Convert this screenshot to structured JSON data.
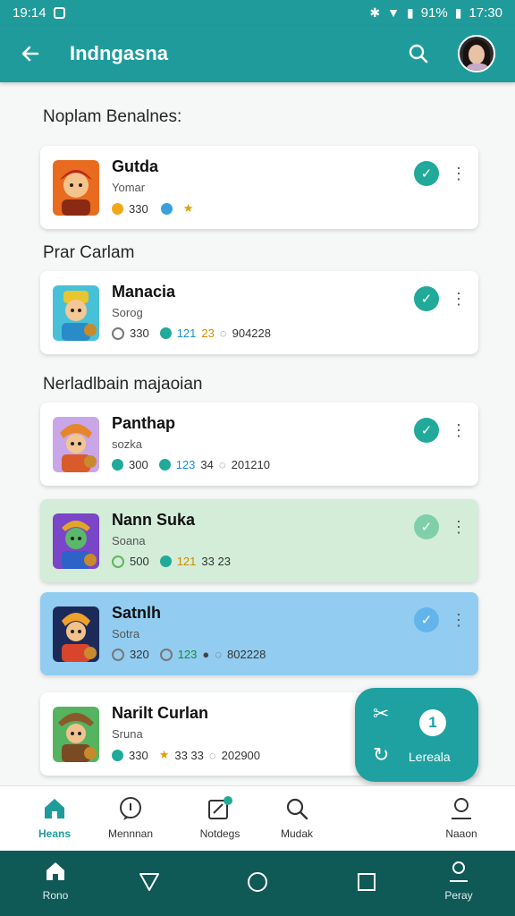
{
  "status_bar": {
    "time": "19:14",
    "battery": "91%",
    "clock_right": "17:30"
  },
  "app_bar": {
    "title": "Indngasna"
  },
  "sections": [
    {
      "title": "Noplam Benalnes:"
    },
    {
      "title": "Prar Carlam"
    },
    {
      "title": "Nerladlbain majaoian"
    }
  ],
  "cards": [
    {
      "title": "Gutda",
      "subtitle": "Yomar",
      "stat1": "330",
      "stat2": "",
      "stat3": "",
      "stat4": "",
      "variant": "white"
    },
    {
      "title": "Manacia",
      "subtitle": "Sorog",
      "stat1": "330",
      "stat2": "121",
      "stat3": "23",
      "stat4": "904228",
      "variant": "white"
    },
    {
      "title": "Panthap",
      "subtitle": "sozka",
      "stat1": "300",
      "stat2": "123",
      "stat3": "34",
      "stat4": "201210",
      "variant": "white"
    },
    {
      "title": "Nann Suka",
      "subtitle": "Soana",
      "stat1": "500",
      "stat2": "121",
      "stat3": "33 23",
      "stat4": "",
      "variant": "green"
    },
    {
      "title": "Satnlh",
      "subtitle": "Sotra",
      "stat1": "320",
      "stat2": "123",
      "stat3": "",
      "stat4": "802228",
      "variant": "blue"
    },
    {
      "title": "Narilt Curlan",
      "subtitle": "Sruna",
      "stat1": "330",
      "stat2": "",
      "stat3": "33 33",
      "stat4": "202900",
      "variant": "white"
    }
  ],
  "fab": {
    "count": "1",
    "label": "Lereala"
  },
  "bottom_nav": [
    {
      "label": "Heans",
      "icon": "home-icon",
      "active": true
    },
    {
      "label": "Mennnan",
      "icon": "message-icon"
    },
    {
      "label": "Notdegs",
      "icon": "edit-icon"
    },
    {
      "label": "Mudak",
      "icon": "search-icon"
    },
    {
      "label": "Naaon",
      "icon": "profile-icon"
    }
  ],
  "system_nav": [
    {
      "label": "Rono",
      "icon": "home-icon"
    },
    {
      "label": "",
      "icon": "back-triangle-icon"
    },
    {
      "label": "",
      "icon": "circle-home-icon"
    },
    {
      "label": "",
      "icon": "square-recents-icon"
    },
    {
      "label": "Peray",
      "icon": "person-icon"
    }
  ],
  "colors": {
    "primary": "#1f9b9b",
    "check": "#21a99a",
    "green_card": "#d3edd9",
    "blue_card": "#92cdf1",
    "system_nav": "#0f5957"
  }
}
